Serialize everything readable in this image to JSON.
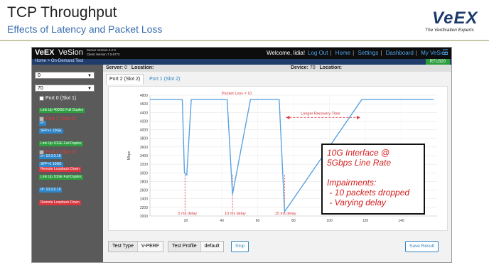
{
  "slide": {
    "title": "TCP Throughput",
    "subtitle": "Effects of Latency and Packet Loss",
    "logo_word": "VeEX",
    "logo_tagline": "The Verification Experts"
  },
  "topbar": {
    "brand_prefix": "VeEX",
    "brand_name": "VeSion",
    "server_version": "Server Version 4.2.0",
    "client_version": "Client Version 7.0.6772",
    "welcome": "Welcome, lidia!",
    "nav": [
      "Log Out",
      "Home",
      "Settings",
      "Dashboard",
      "My VeSion"
    ],
    "menu_icon": "hamburger-icon"
  },
  "breadcrumb": {
    "home": "Home",
    "separator": ">",
    "current": "On-Demand Test",
    "device_badge": "RTU320"
  },
  "sidebar": {
    "select1": "0",
    "select2": "70",
    "ports": [
      {
        "name": "Port 0 (Slot 1)",
        "checked": false,
        "status": "normal",
        "badges": [
          {
            "text": "Link Up 400GE Full Duplex",
            "color": "green"
          },
          {
            "text": "IP:",
            "color": "blue"
          }
        ]
      },
      {
        "name": "Port 1 (Slot 1)",
        "checked": true,
        "status": "error",
        "badges": [
          {
            "text": "SFP+1 10GE",
            "color": "blue"
          },
          {
            "text": "Link Up 10GE Full Duplex",
            "color": "green"
          },
          {
            "text": "IP: 10.0.0.18",
            "color": "blue"
          },
          {
            "text": "Remote Loopback Down",
            "color": "red"
          }
        ]
      },
      {
        "name": "Port 2 (Slot 2)",
        "checked": true,
        "status": "error",
        "badges": [
          {
            "text": "SFP+2 10GE",
            "color": "blue"
          },
          {
            "text": "Link Up 10GE Full Duplex",
            "color": "green"
          },
          {
            "text": "IP: 10.0.0.19",
            "color": "blue"
          },
          {
            "text": "Remote Loopback Down",
            "color": "red"
          }
        ]
      }
    ]
  },
  "infobar": {
    "server_label": "Server:",
    "server_value": "0",
    "location_label": "Location:",
    "device_label": "Device:",
    "device_value": "70",
    "location2_label": "Location:"
  },
  "tabs": [
    "Port 2 (Slot 2)",
    "Port 1 (Slot 2)"
  ],
  "chart_data": {
    "type": "line",
    "ylabel": "Mbps",
    "xlim": [
      0,
      160
    ],
    "ylim": [
      2000,
      4800
    ],
    "xticks": [
      20,
      40,
      60,
      80,
      100,
      120,
      140
    ],
    "yticks": [
      2000,
      2200,
      2400,
      2600,
      2800,
      3000,
      3200,
      3400,
      3600,
      3800,
      4000,
      4200,
      4400,
      4600,
      4800
    ],
    "series": [
      {
        "values": [
          [
            0,
            4700
          ],
          [
            18,
            4700
          ],
          [
            19.2,
            3000
          ],
          [
            20.5,
            2950
          ],
          [
            23,
            4700
          ],
          [
            43,
            4700
          ],
          [
            46,
            2500
          ],
          [
            56,
            4700
          ],
          [
            72,
            4700
          ],
          [
            75,
            2100
          ],
          [
            118,
            4700
          ],
          [
            158,
            4700
          ]
        ]
      }
    ],
    "annotations": [
      {
        "text": "Packet Loss = 10",
        "x": 40,
        "y": 4800
      },
      {
        "text": "5 ms delay",
        "x": 18,
        "y": 2050
      },
      {
        "text": "10 ms delay",
        "x": 44,
        "y": 2050
      },
      {
        "text": "15 ms delay",
        "x": 72,
        "y": 2050
      },
      {
        "text": "Longer Recovery Time",
        "x": 95,
        "y": 4350
      }
    ],
    "drop_markers": [
      19.5,
      46,
      75
    ],
    "recovery_span": [
      75,
      118
    ],
    "line_color": "#5ba3e0",
    "annotation_color": "#d9363e"
  },
  "bottombar": {
    "test_type_label": "Test Type",
    "test_type_value": "V-PERF",
    "test_profile_label": "Test Profile",
    "test_profile_value": "default",
    "stop": "Stop",
    "save": "Save Result"
  },
  "callout": {
    "line1": "10G Interface @",
    "line2": "5Gbps Line Rate",
    "line3": "Impairments:",
    "line4": " - 10 packets dropped",
    "line5": " - Varying delay"
  }
}
